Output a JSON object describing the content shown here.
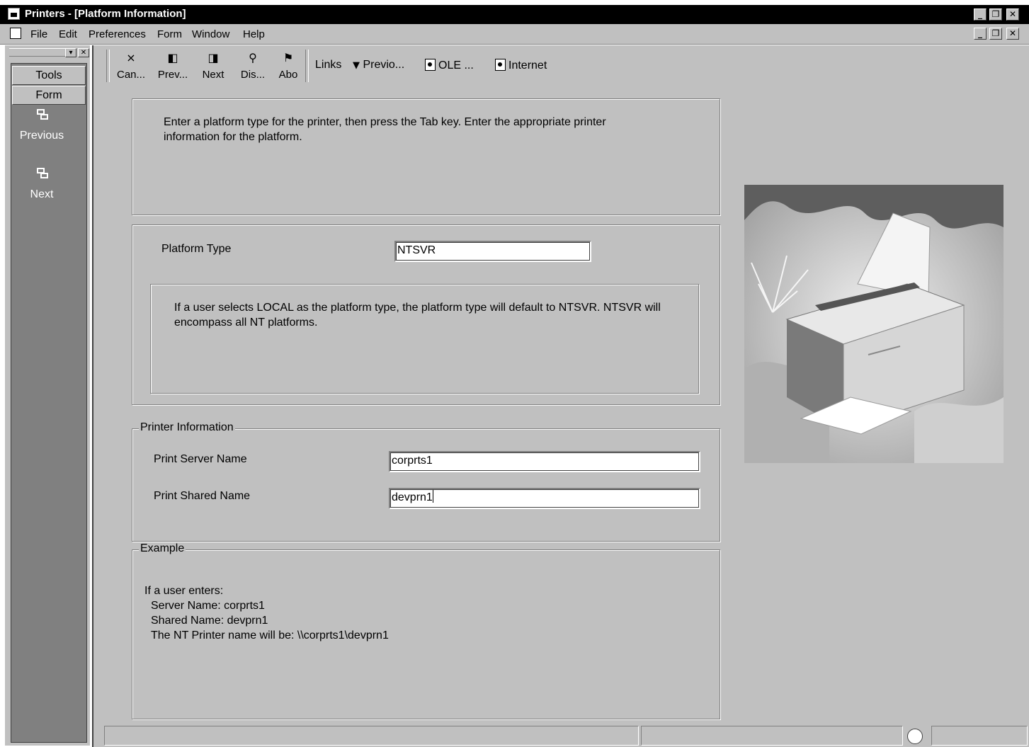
{
  "window": {
    "title": "Printers - [Platform Information]",
    "controls": [
      "minimize",
      "restore",
      "close"
    ]
  },
  "menu": {
    "items": [
      {
        "label": "File"
      },
      {
        "label": "Edit"
      },
      {
        "label": "Preferences"
      },
      {
        "label": "Form"
      },
      {
        "label": "Window"
      },
      {
        "label": "Help"
      }
    ]
  },
  "sidebar": {
    "tabs": [
      {
        "label": "Tools"
      },
      {
        "label": "Form"
      }
    ],
    "nav": [
      {
        "label": "Previous",
        "icon": "previous-icon"
      },
      {
        "label": "Next",
        "icon": "next-icon"
      }
    ]
  },
  "toolbar": {
    "buttons": [
      {
        "label": "Can...",
        "icon": "×"
      },
      {
        "label": "Prev...",
        "icon": "◧"
      },
      {
        "label": "Next",
        "icon": "◨"
      },
      {
        "label": "Dis...",
        "icon": "⚲"
      },
      {
        "label": "Abo",
        "icon": "⚑"
      }
    ],
    "links_label": "Links",
    "link_items": [
      {
        "label": "Previo...",
        "icon": "dropdown-arrow"
      },
      {
        "label": "OLE ...",
        "icon": "document-icon"
      },
      {
        "label": "Internet",
        "icon": "document-icon"
      }
    ]
  },
  "form": {
    "instructions": "Enter a platform type for the printer, then press the Tab key.  Enter the appropriate printer information for the platform.",
    "platform": {
      "label": "Platform Type",
      "value": "NTSVR",
      "note": "If a user selects LOCAL as the platform type, the platform type will default to NTSVR.  NTSVR will encompass all NT platforms."
    },
    "printer_info": {
      "legend": "Printer Information",
      "server_label": "Print Server Name",
      "server_value": "corprts1",
      "shared_label": "Print Shared Name",
      "shared_value": "devprn1"
    },
    "example": {
      "legend": "Example",
      "lines": [
        "If a user enters:",
        "Server Name: corprts1",
        "Shared Name: devprn1",
        "The NT Printer name will be: \\\\corprts1\\devprn1"
      ]
    }
  },
  "colors": {
    "face": "#c0c0c0",
    "sidebar": "#808080",
    "titlebar": "#000000"
  }
}
